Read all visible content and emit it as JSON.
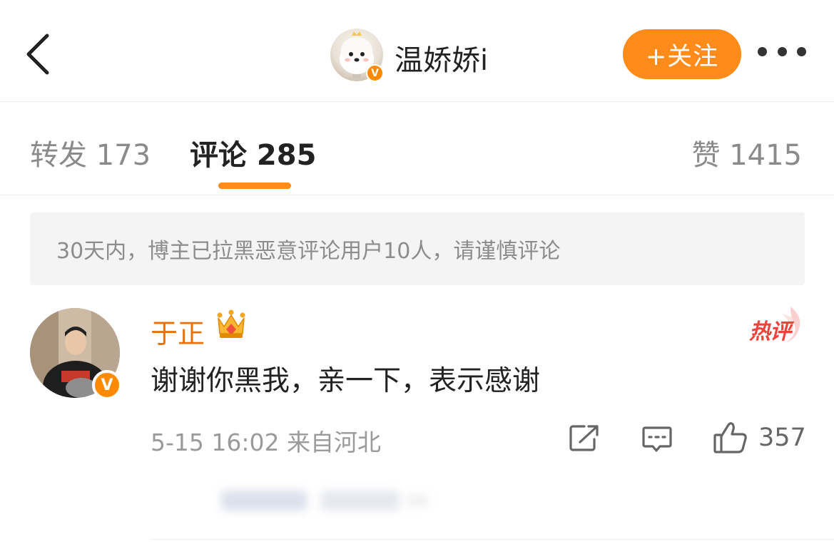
{
  "header": {
    "username": "温娇娇i",
    "follow_label": "+关注",
    "verified_badge": "V",
    "icons": {
      "back": "chevron-left-icon",
      "more": "more-horizontal-icon"
    }
  },
  "tabs": [
    {
      "label": "转发 173",
      "active": false
    },
    {
      "label": "评论 285",
      "active": true
    },
    {
      "label": "赞 1415",
      "active": false
    }
  ],
  "notice": "30天内，博主已拉黑恶意评论用户10人，请谨慎评论",
  "comment": {
    "author": "于正",
    "verified_badge": "V",
    "hot_label": "热评",
    "text": "谢谢你黑我，亲一下，表示感谢",
    "meta": "5-15 16:02 来自河北",
    "likes": "357",
    "icons": [
      "share-icon",
      "reply-icon",
      "thumbs-up-icon",
      "crown-icon"
    ]
  },
  "colors": {
    "accent": "#ff8c1a",
    "name_orange": "#e8710a",
    "hot_red": "#f2403a"
  }
}
